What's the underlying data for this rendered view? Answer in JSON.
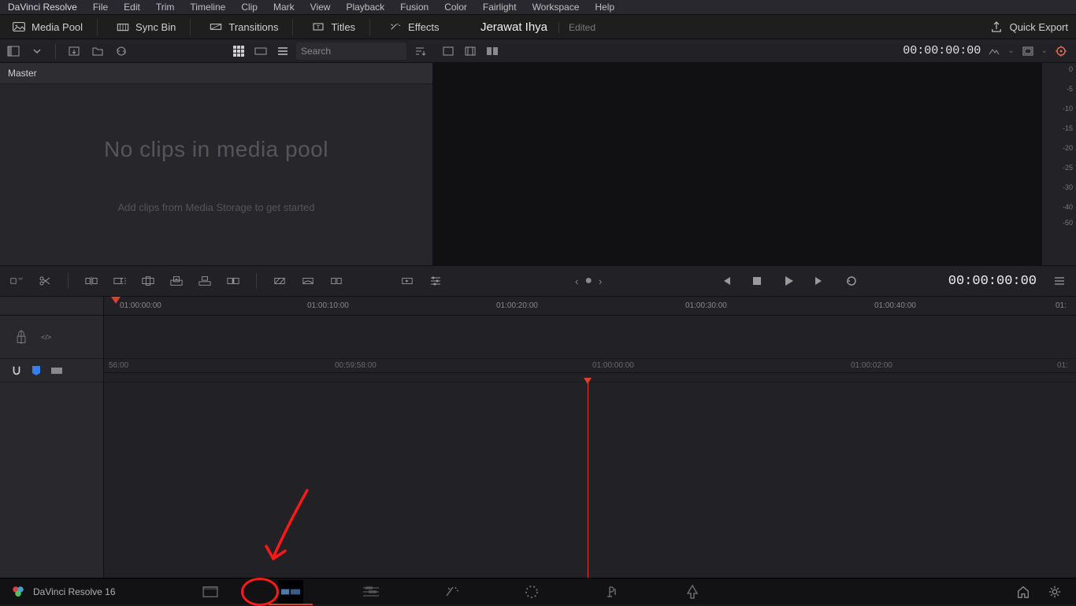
{
  "menu": {
    "app": "DaVinci Resolve",
    "items": [
      "File",
      "Edit",
      "Trim",
      "Timeline",
      "Clip",
      "Mark",
      "View",
      "Playback",
      "Fusion",
      "Color",
      "Fairlight",
      "Workspace",
      "Help"
    ]
  },
  "browse": {
    "media_pool": "Media Pool",
    "sync_bin": "Sync Bin",
    "transitions": "Transitions",
    "titles": "Titles",
    "effects": "Effects",
    "project_name": "Jerawat Ihya",
    "project_status": "Edited",
    "quick_export": "Quick Export"
  },
  "toolstrip": {
    "search_placeholder": "Search",
    "viewer_tc": "00:00:00:00"
  },
  "mediapool": {
    "master": "Master",
    "empty": "No clips in media pool",
    "hint": "Add clips from Media Storage to get started"
  },
  "meters": {
    "labels": [
      "0",
      "-5",
      "-10",
      "-15",
      "-20",
      "-25",
      "-30",
      "-40",
      "-50"
    ]
  },
  "edit": {
    "src_tc": "00:00:00:00"
  },
  "ruler_top": {
    "labels": [
      "01:00:00:00",
      "01:00:10:00",
      "01:00:20:00",
      "01:00:30:00",
      "01:00:40:00"
    ],
    "last_frag": "01:"
  },
  "ruler_bottom": {
    "labels": [
      "56:00",
      "00:59:58:00",
      "01:00:00:00",
      "01:00:02:00"
    ],
    "last_frag": "01:"
  },
  "pagebar": {
    "app_label": "DaVinci Resolve 16"
  }
}
